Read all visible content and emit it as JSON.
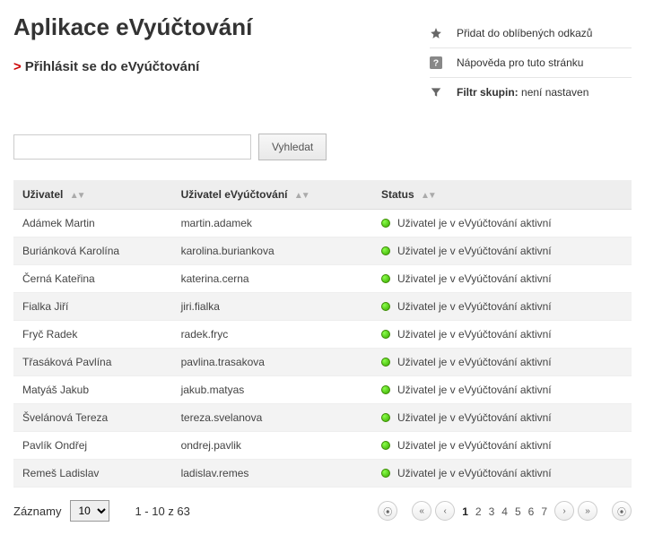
{
  "title": "Aplikace eVyúčtování",
  "login_link": "Přihlásit se do eVyúčtování",
  "actions": {
    "favorite": "Přidat do oblíbených odkazů",
    "help": "Nápověda pro tuto stránku",
    "filter_label": "Filtr skupin:",
    "filter_value": "není nastaven"
  },
  "search": {
    "value": "",
    "button": "Vyhledat"
  },
  "columns": {
    "user": "Uživatel",
    "euser": "Uživatel eVyúčtování",
    "status": "Status"
  },
  "status_text": "Uživatel je v eVyúčtování aktivní",
  "rows": [
    {
      "user": "Adámek Martin",
      "euser": "martin.adamek"
    },
    {
      "user": "Buriánková Karolína",
      "euser": "karolina.buriankova"
    },
    {
      "user": "Černá Kateřina",
      "euser": "katerina.cerna"
    },
    {
      "user": "Fialka Jiří",
      "euser": "jiri.fialka"
    },
    {
      "user": "Fryč Radek",
      "euser": "radek.fryc"
    },
    {
      "user": "Třasáková Pavlína",
      "euser": "pavlina.trasakova"
    },
    {
      "user": "Matyáš Jakub",
      "euser": "jakub.matyas"
    },
    {
      "user": "Švelánová Tereza",
      "euser": "tereza.svelanova"
    },
    {
      "user": "Pavlík Ondřej",
      "euser": "ondrej.pavlik"
    },
    {
      "user": "Remeš Ladislav",
      "euser": "ladislav.remes"
    }
  ],
  "footer": {
    "records_label": "Záznamy",
    "per_page": "10",
    "range": "1 - 10 z 63",
    "pages": [
      "1",
      "2",
      "3",
      "4",
      "5",
      "6",
      "7"
    ],
    "current_page": "1"
  }
}
